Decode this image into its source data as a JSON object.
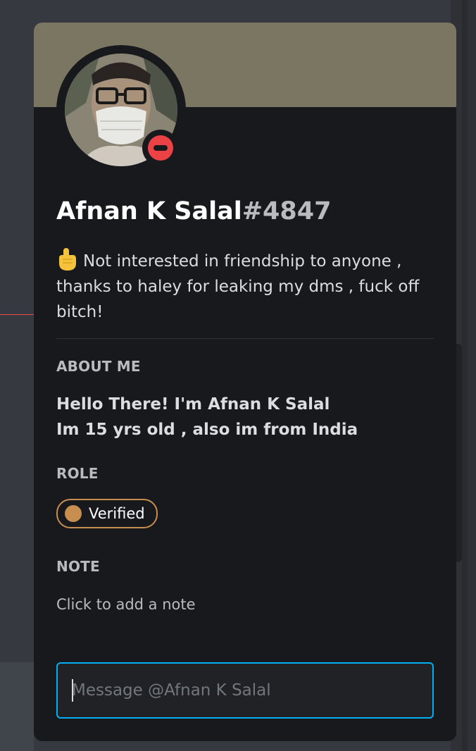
{
  "profile": {
    "display_name": "Afnan K Salal",
    "discriminator": "#4847",
    "status_icon": "do-not-disturb-icon",
    "banner_color": "#7a7661",
    "custom_status": {
      "emoji": "raised-hand-emoji",
      "text": "Not interested in friendship to anyone , thanks to haley for leaking my dms , fuck off bitch!"
    },
    "about_me": {
      "title": "ABOUT ME",
      "line1": "Hello There! I'm Afnan K Salal",
      "line2": "Im 15 yrs old , also im from India"
    },
    "roles": {
      "title": "ROLE",
      "items": [
        {
          "name": "Verified",
          "color": "#c88e4f"
        }
      ]
    },
    "note": {
      "title": "NOTE",
      "placeholder": "Click to add a note"
    },
    "message": {
      "placeholder": "Message @Afnan K Salal"
    }
  }
}
